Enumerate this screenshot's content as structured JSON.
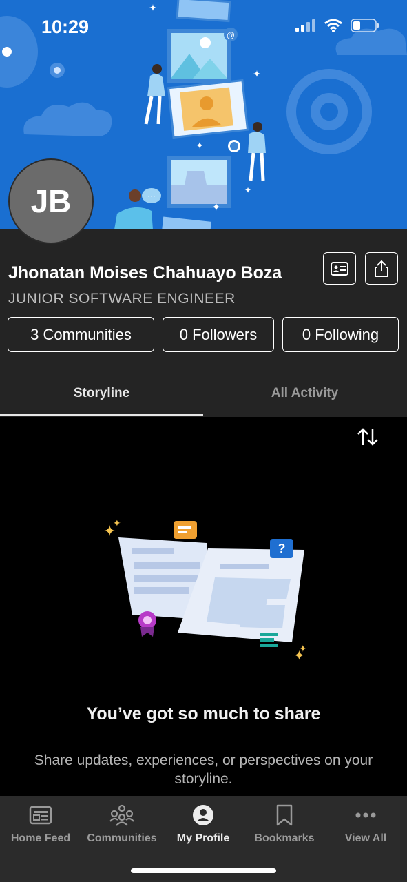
{
  "status_bar": {
    "time": "10:29"
  },
  "profile": {
    "initials": "JB",
    "name": "Jhonatan Moises Chahuayo Boza",
    "headline": "JUNIOR SOFTWARE ENGINEER"
  },
  "stats": {
    "communities": "3 Communities",
    "followers": "0 Followers",
    "following": "0 Following"
  },
  "tabs": [
    {
      "label": "Storyline",
      "active": true
    },
    {
      "label": "All Activity",
      "active": false
    }
  ],
  "empty_state": {
    "title": "You’ve got so much to share",
    "description": "Share updates, experiences, or perspectives on your storyline."
  },
  "bottom_nav": [
    {
      "label": "Home Feed",
      "icon": "news-icon",
      "active": false
    },
    {
      "label": "Communities",
      "icon": "people-group-icon",
      "active": false
    },
    {
      "label": "My Profile",
      "icon": "person-icon",
      "active": true
    },
    {
      "label": "Bookmarks",
      "icon": "bookmark-icon",
      "active": false
    },
    {
      "label": "View All",
      "icon": "more-icon",
      "active": false
    }
  ],
  "colors": {
    "banner": "#1a6fd1",
    "panel": "#242424",
    "nav": "#2b2b2b"
  }
}
